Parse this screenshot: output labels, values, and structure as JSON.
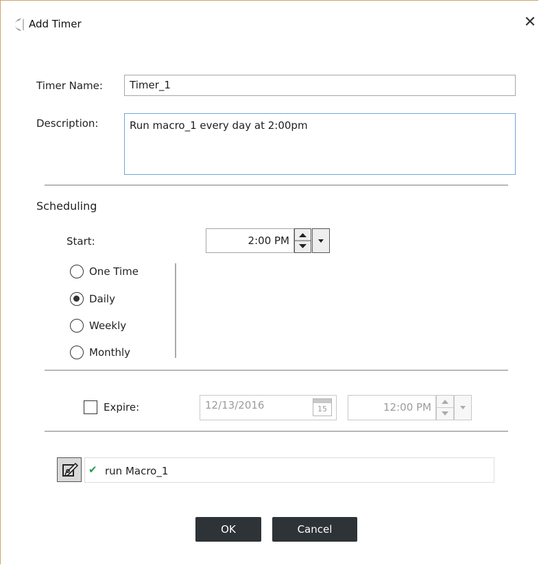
{
  "window": {
    "title": "Add Timer",
    "close_glyph": "✕"
  },
  "form": {
    "timer_name_label": "Timer Name:",
    "timer_name_value": "Timer_1",
    "description_label": "Description:",
    "description_value": "Run macro_1 every day at 2:00pm"
  },
  "scheduling": {
    "heading": "Scheduling",
    "start_label": "Start:",
    "start_time": "2:00 PM",
    "options": [
      {
        "label": "One Time",
        "selected": false
      },
      {
        "label": "Daily",
        "selected": true
      },
      {
        "label": "Weekly",
        "selected": false
      },
      {
        "label": "Monthly",
        "selected": false
      }
    ]
  },
  "expire": {
    "label": "Expire:",
    "checked": false,
    "date": "12/13/2016",
    "calendar_day": "15",
    "time": "12:00 PM"
  },
  "action": {
    "check_glyph": "✔",
    "text": "run Macro_1"
  },
  "buttons": {
    "ok": "OK",
    "cancel": "Cancel"
  },
  "colors": {
    "accent_border": "#6da7de",
    "check_green": "#1e9e4a",
    "button_bg": "#2e3338"
  }
}
